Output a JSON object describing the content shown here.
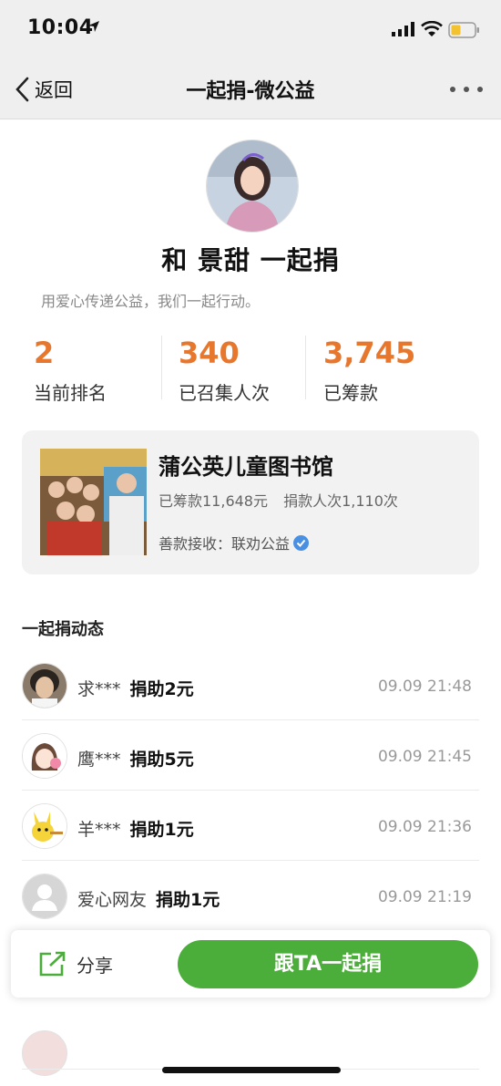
{
  "status_bar": {
    "time": "10:04"
  },
  "nav": {
    "back_label": "返回",
    "title": "一起捐-微公益"
  },
  "profile": {
    "name": "和 景甜 一起捐",
    "slogan": "用爱心传递公益，我们一起行动。"
  },
  "stats": [
    {
      "value": "2",
      "label": "当前排名"
    },
    {
      "value": "340",
      "label": "已召集人次"
    },
    {
      "value": "3,745",
      "label": "已筹款"
    }
  ],
  "project": {
    "title": "蒲公英儿童图书馆",
    "raised": "已筹款11,648元",
    "donors": "捐款人次1,110次",
    "receiver": "善款接收：联劝公益"
  },
  "feed": {
    "title": "一起捐动态",
    "items": [
      {
        "user": "求***",
        "amount": "捐助2元",
        "time": "09.09 21:48",
        "avatar": "child-photo-avatar"
      },
      {
        "user": "鹰***",
        "amount": "捐助5元",
        "time": "09.09 21:45",
        "avatar": "cartoon-girl-avatar"
      },
      {
        "user": "羊***",
        "amount": "捐助1元",
        "time": "09.09 21:36",
        "avatar": "pikachu-avatar"
      },
      {
        "user": "爱心网友",
        "amount": "捐助1元",
        "time": "09.09 21:19",
        "avatar": "default-user-avatar"
      }
    ]
  },
  "actions": {
    "share_label": "分享",
    "donate_label": "跟TA一起捐"
  },
  "colors": {
    "accent_orange": "#e8772e",
    "donate_green": "#4cae3a",
    "verified_blue": "#4a90e2"
  }
}
